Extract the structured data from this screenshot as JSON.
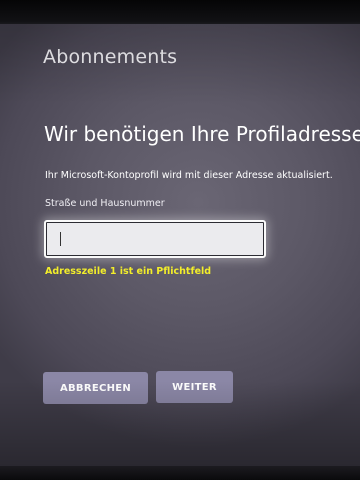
{
  "header": {
    "section_title": "Abonnements"
  },
  "form": {
    "heading": "Wir benötigen Ihre Profiladresse.",
    "description": "Ihr Microsoft-Kontoprofil wird mit dieser Adresse aktualisiert.",
    "street_field": {
      "label": "Straße und Hausnummer",
      "value": "",
      "placeholder": ""
    },
    "error_message": "Adresszeile 1 ist ein Pflichtfeld"
  },
  "actions": {
    "cancel_label": "ABBRECHEN",
    "next_label": "WEITER"
  },
  "colors": {
    "screen_background": "#5c5866",
    "button_background": "#8b87a6",
    "error_text": "#f3ee2a",
    "text": "#ffffff"
  }
}
